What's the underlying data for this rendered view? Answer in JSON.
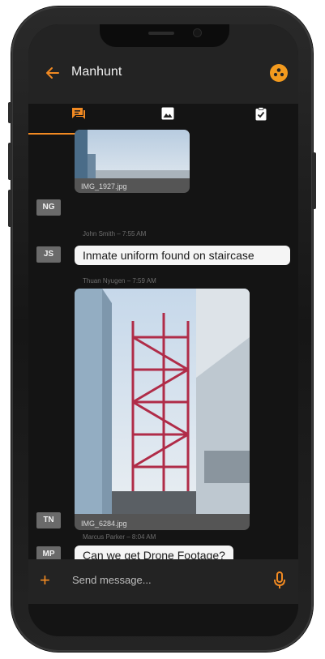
{
  "header": {
    "title": "Manhunt",
    "back_icon": "back-arrow-icon",
    "team_icon": "group-icon"
  },
  "tabs": [
    {
      "icon": "chat-icon",
      "active": true
    },
    {
      "icon": "image-icon",
      "active": false
    },
    {
      "icon": "clipboard-check-icon",
      "active": false
    }
  ],
  "messages": [
    {
      "initials": "NG",
      "type": "image",
      "filename": "IMG_1927.jpg"
    },
    {
      "initials": "JS",
      "meta": "John Smith – 7:55 AM",
      "type": "text",
      "text": "Inmate uniform found on staircase"
    },
    {
      "initials": "TN",
      "meta": "Thuan Nyugen – 7:59 AM",
      "type": "image",
      "filename": "IMG_6284.jpg"
    },
    {
      "initials": "MP",
      "meta": "Marcus Parker – 8:04 AM",
      "type": "text",
      "text": "Can we get Drone Footage?"
    }
  ],
  "composer": {
    "placeholder": "Send message...",
    "plus_icon": "plus-icon",
    "mic_icon": "microphone-icon"
  },
  "colors": {
    "accent": "#f28a22",
    "background": "#141414",
    "bar": "#232323"
  }
}
